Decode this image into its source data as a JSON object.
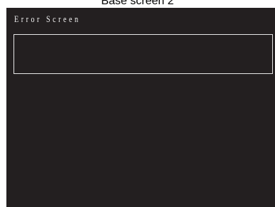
{
  "caption": "Base screen 2",
  "screen": {
    "title": "Error Screen",
    "message": ""
  },
  "colors": {
    "screen_background": "#231f20",
    "text": "#f2f2f2",
    "box_border": "#e6e6e6"
  }
}
